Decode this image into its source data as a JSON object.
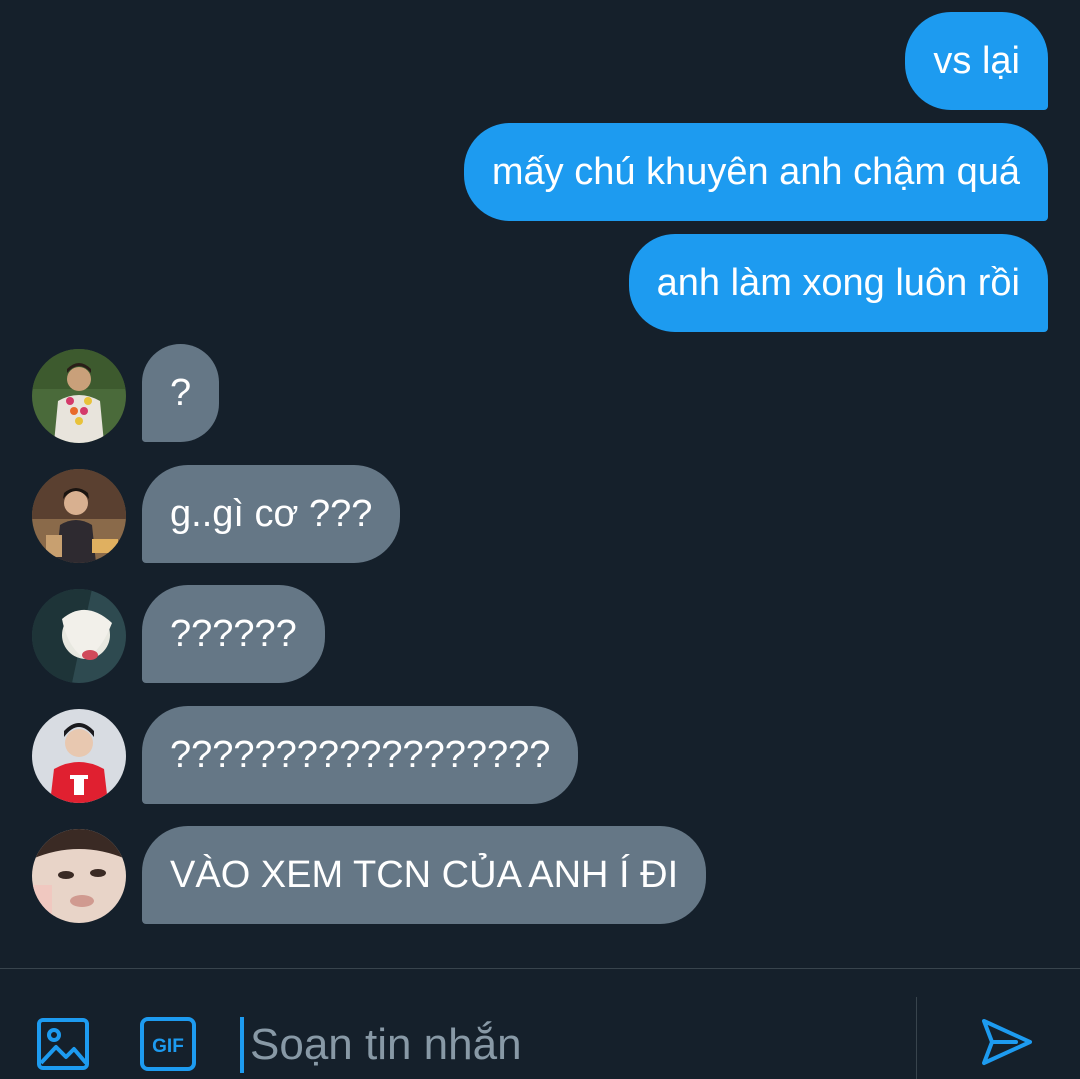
{
  "conversation": {
    "messages": [
      {
        "direction": "sent",
        "text": "vs lại"
      },
      {
        "direction": "sent",
        "text": "mấy chú khuyên anh chậm quá"
      },
      {
        "direction": "sent",
        "text": "anh làm xong luôn rồi"
      },
      {
        "direction": "received",
        "text": "?"
      },
      {
        "direction": "received",
        "text": "g..gì cơ ???"
      },
      {
        "direction": "received",
        "text": "??????"
      },
      {
        "direction": "received",
        "text": "??????????????????"
      },
      {
        "direction": "received",
        "text": "VÀO XEM TCN CỦA ANH Í ĐI"
      }
    ]
  },
  "composer": {
    "placeholder": "Soạn tin nhắn",
    "gif_label": "GIF",
    "icons": {
      "media": "image-icon",
      "gif": "gif-icon",
      "send": "send-icon"
    }
  },
  "colors": {
    "background": "#15202b",
    "sent_bubble": "#1d9bf0",
    "received_bubble": "#657786",
    "accent": "#1d9bf0",
    "divider": "#38444d"
  }
}
